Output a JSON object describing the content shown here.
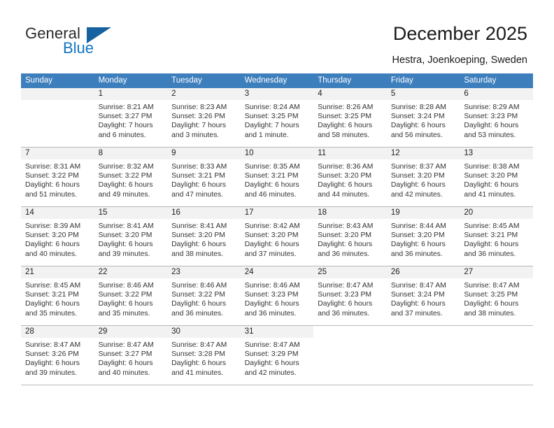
{
  "brand": {
    "word_general": "General",
    "word_blue": "Blue",
    "triangle_color": "#16619f",
    "blue_color": "#1275c4"
  },
  "header": {
    "title": "December 2025",
    "subtitle": "Hestra, Joenkoeping, Sweden",
    "header_bg": "#3d7ebd",
    "daynum_bg": "#f2f2f2"
  },
  "weekday_headers": [
    "Sunday",
    "Monday",
    "Tuesday",
    "Wednesday",
    "Thursday",
    "Friday",
    "Saturday"
  ],
  "weeks": [
    [
      {
        "day": "",
        "sunrise": "",
        "sunset": "",
        "daylight1": "",
        "daylight2": ""
      },
      {
        "day": "1",
        "sunrise": "Sunrise: 8:21 AM",
        "sunset": "Sunset: 3:27 PM",
        "daylight1": "Daylight: 7 hours",
        "daylight2": "and 6 minutes."
      },
      {
        "day": "2",
        "sunrise": "Sunrise: 8:23 AM",
        "sunset": "Sunset: 3:26 PM",
        "daylight1": "Daylight: 7 hours",
        "daylight2": "and 3 minutes."
      },
      {
        "day": "3",
        "sunrise": "Sunrise: 8:24 AM",
        "sunset": "Sunset: 3:25 PM",
        "daylight1": "Daylight: 7 hours",
        "daylight2": "and 1 minute."
      },
      {
        "day": "4",
        "sunrise": "Sunrise: 8:26 AM",
        "sunset": "Sunset: 3:25 PM",
        "daylight1": "Daylight: 6 hours",
        "daylight2": "and 58 minutes."
      },
      {
        "day": "5",
        "sunrise": "Sunrise: 8:28 AM",
        "sunset": "Sunset: 3:24 PM",
        "daylight1": "Daylight: 6 hours",
        "daylight2": "and 56 minutes."
      },
      {
        "day": "6",
        "sunrise": "Sunrise: 8:29 AM",
        "sunset": "Sunset: 3:23 PM",
        "daylight1": "Daylight: 6 hours",
        "daylight2": "and 53 minutes."
      }
    ],
    [
      {
        "day": "7",
        "sunrise": "Sunrise: 8:31 AM",
        "sunset": "Sunset: 3:22 PM",
        "daylight1": "Daylight: 6 hours",
        "daylight2": "and 51 minutes."
      },
      {
        "day": "8",
        "sunrise": "Sunrise: 8:32 AM",
        "sunset": "Sunset: 3:22 PM",
        "daylight1": "Daylight: 6 hours",
        "daylight2": "and 49 minutes."
      },
      {
        "day": "9",
        "sunrise": "Sunrise: 8:33 AM",
        "sunset": "Sunset: 3:21 PM",
        "daylight1": "Daylight: 6 hours",
        "daylight2": "and 47 minutes."
      },
      {
        "day": "10",
        "sunrise": "Sunrise: 8:35 AM",
        "sunset": "Sunset: 3:21 PM",
        "daylight1": "Daylight: 6 hours",
        "daylight2": "and 46 minutes."
      },
      {
        "day": "11",
        "sunrise": "Sunrise: 8:36 AM",
        "sunset": "Sunset: 3:20 PM",
        "daylight1": "Daylight: 6 hours",
        "daylight2": "and 44 minutes."
      },
      {
        "day": "12",
        "sunrise": "Sunrise: 8:37 AM",
        "sunset": "Sunset: 3:20 PM",
        "daylight1": "Daylight: 6 hours",
        "daylight2": "and 42 minutes."
      },
      {
        "day": "13",
        "sunrise": "Sunrise: 8:38 AM",
        "sunset": "Sunset: 3:20 PM",
        "daylight1": "Daylight: 6 hours",
        "daylight2": "and 41 minutes."
      }
    ],
    [
      {
        "day": "14",
        "sunrise": "Sunrise: 8:39 AM",
        "sunset": "Sunset: 3:20 PM",
        "daylight1": "Daylight: 6 hours",
        "daylight2": "and 40 minutes."
      },
      {
        "day": "15",
        "sunrise": "Sunrise: 8:41 AM",
        "sunset": "Sunset: 3:20 PM",
        "daylight1": "Daylight: 6 hours",
        "daylight2": "and 39 minutes."
      },
      {
        "day": "16",
        "sunrise": "Sunrise: 8:41 AM",
        "sunset": "Sunset: 3:20 PM",
        "daylight1": "Daylight: 6 hours",
        "daylight2": "and 38 minutes."
      },
      {
        "day": "17",
        "sunrise": "Sunrise: 8:42 AM",
        "sunset": "Sunset: 3:20 PM",
        "daylight1": "Daylight: 6 hours",
        "daylight2": "and 37 minutes."
      },
      {
        "day": "18",
        "sunrise": "Sunrise: 8:43 AM",
        "sunset": "Sunset: 3:20 PM",
        "daylight1": "Daylight: 6 hours",
        "daylight2": "and 36 minutes."
      },
      {
        "day": "19",
        "sunrise": "Sunrise: 8:44 AM",
        "sunset": "Sunset: 3:20 PM",
        "daylight1": "Daylight: 6 hours",
        "daylight2": "and 36 minutes."
      },
      {
        "day": "20",
        "sunrise": "Sunrise: 8:45 AM",
        "sunset": "Sunset: 3:21 PM",
        "daylight1": "Daylight: 6 hours",
        "daylight2": "and 36 minutes."
      }
    ],
    [
      {
        "day": "21",
        "sunrise": "Sunrise: 8:45 AM",
        "sunset": "Sunset: 3:21 PM",
        "daylight1": "Daylight: 6 hours",
        "daylight2": "and 35 minutes."
      },
      {
        "day": "22",
        "sunrise": "Sunrise: 8:46 AM",
        "sunset": "Sunset: 3:22 PM",
        "daylight1": "Daylight: 6 hours",
        "daylight2": "and 35 minutes."
      },
      {
        "day": "23",
        "sunrise": "Sunrise: 8:46 AM",
        "sunset": "Sunset: 3:22 PM",
        "daylight1": "Daylight: 6 hours",
        "daylight2": "and 36 minutes."
      },
      {
        "day": "24",
        "sunrise": "Sunrise: 8:46 AM",
        "sunset": "Sunset: 3:23 PM",
        "daylight1": "Daylight: 6 hours",
        "daylight2": "and 36 minutes."
      },
      {
        "day": "25",
        "sunrise": "Sunrise: 8:47 AM",
        "sunset": "Sunset: 3:23 PM",
        "daylight1": "Daylight: 6 hours",
        "daylight2": "and 36 minutes."
      },
      {
        "day": "26",
        "sunrise": "Sunrise: 8:47 AM",
        "sunset": "Sunset: 3:24 PM",
        "daylight1": "Daylight: 6 hours",
        "daylight2": "and 37 minutes."
      },
      {
        "day": "27",
        "sunrise": "Sunrise: 8:47 AM",
        "sunset": "Sunset: 3:25 PM",
        "daylight1": "Daylight: 6 hours",
        "daylight2": "and 38 minutes."
      }
    ],
    [
      {
        "day": "28",
        "sunrise": "Sunrise: 8:47 AM",
        "sunset": "Sunset: 3:26 PM",
        "daylight1": "Daylight: 6 hours",
        "daylight2": "and 39 minutes."
      },
      {
        "day": "29",
        "sunrise": "Sunrise: 8:47 AM",
        "sunset": "Sunset: 3:27 PM",
        "daylight1": "Daylight: 6 hours",
        "daylight2": "and 40 minutes."
      },
      {
        "day": "30",
        "sunrise": "Sunrise: 8:47 AM",
        "sunset": "Sunset: 3:28 PM",
        "daylight1": "Daylight: 6 hours",
        "daylight2": "and 41 minutes."
      },
      {
        "day": "31",
        "sunrise": "Sunrise: 8:47 AM",
        "sunset": "Sunset: 3:29 PM",
        "daylight1": "Daylight: 6 hours",
        "daylight2": "and 42 minutes."
      },
      {
        "day": "",
        "sunrise": "",
        "sunset": "",
        "daylight1": "",
        "daylight2": ""
      },
      {
        "day": "",
        "sunrise": "",
        "sunset": "",
        "daylight1": "",
        "daylight2": ""
      },
      {
        "day": "",
        "sunrise": "",
        "sunset": "",
        "daylight1": "",
        "daylight2": ""
      }
    ]
  ]
}
